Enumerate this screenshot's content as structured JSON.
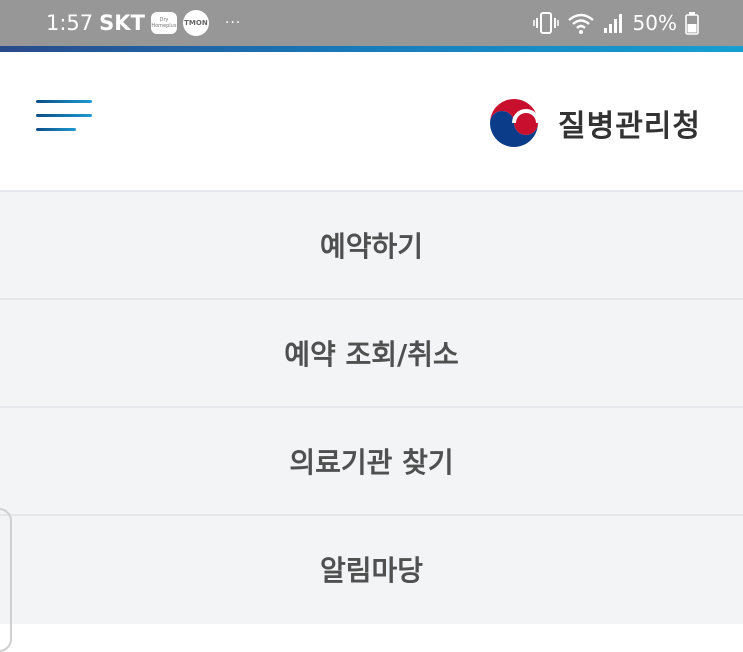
{
  "status_bar": {
    "time": "1:57",
    "carrier": "SKT",
    "app_badge": "Dry Homeplus",
    "app_circle": "TMON",
    "more": "···",
    "battery": "50%"
  },
  "header": {
    "org_name": "질병관리청"
  },
  "menu": {
    "items": [
      {
        "label": "예약하기"
      },
      {
        "label": "예약 조회/취소"
      },
      {
        "label": "의료기관 찾기"
      },
      {
        "label": "알림마당"
      }
    ]
  },
  "colors": {
    "status_bar": "#979797",
    "accent_gradient_start": "#2a4a8a",
    "accent_gradient_end": "#16a0d2",
    "menu_bg": "#f3f4f6",
    "menu_text": "#505050",
    "logo_red": "#c8102e",
    "logo_blue": "#0b3c8a"
  },
  "icons": [
    "vibrate-icon",
    "wifi-icon",
    "signal-icon",
    "battery-icon",
    "hamburger-icon",
    "korea-gov-logo-icon"
  ]
}
